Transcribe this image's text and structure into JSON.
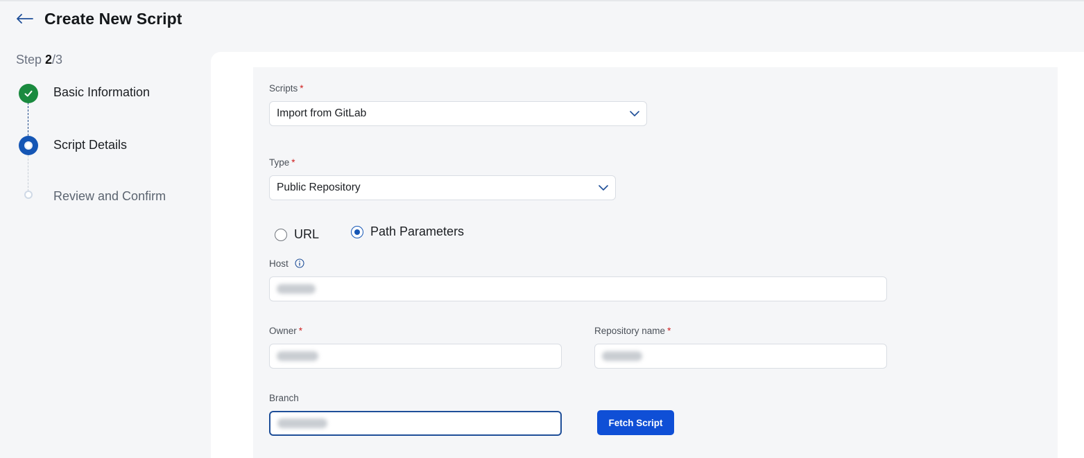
{
  "header": {
    "title": "Create New Script",
    "back_icon": "arrow-left-icon"
  },
  "stepper": {
    "prefix": "Step ",
    "current": "2",
    "total": "/3",
    "steps": [
      {
        "label": "Basic Information",
        "state": "done"
      },
      {
        "label": "Script Details",
        "state": "active"
      },
      {
        "label": "Review and Confirm",
        "state": "pending"
      }
    ]
  },
  "form": {
    "scripts": {
      "label": "Scripts",
      "required": "*",
      "value": "Import from GitLab"
    },
    "type": {
      "label": "Type",
      "required": "*",
      "value": "Public Repository"
    },
    "mode": {
      "options": [
        {
          "label": "URL",
          "selected": false
        },
        {
          "label": "Path Parameters",
          "selected": true
        }
      ]
    },
    "host": {
      "label": "Host",
      "value": ""
    },
    "owner": {
      "label": "Owner",
      "required": "*",
      "value": ""
    },
    "repository": {
      "label": "Repository name",
      "required": "*",
      "value": ""
    },
    "branch": {
      "label": "Branch",
      "value": ""
    },
    "fetch_button": "Fetch Script"
  },
  "colors": {
    "accent": "#1556b5",
    "success": "#1a8a3f",
    "button": "#0f4fd6",
    "required": "#d02020"
  }
}
